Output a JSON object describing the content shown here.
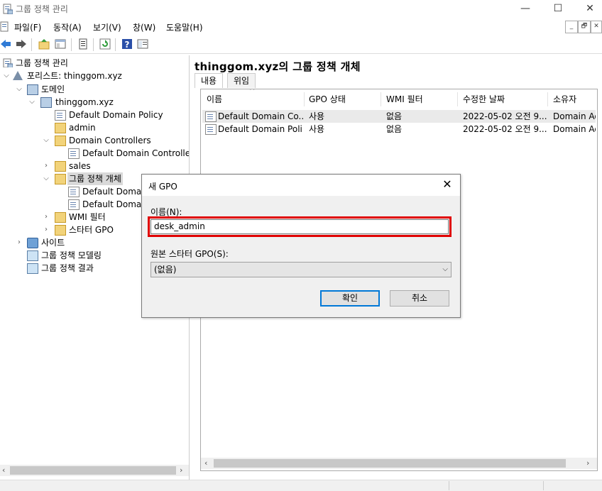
{
  "window": {
    "title": "그룹 정책 관리",
    "controls": {
      "minimize": "—",
      "maximize": "☐",
      "close": "✕"
    }
  },
  "menu": {
    "items": [
      "파일(F)",
      "동작(A)",
      "보기(V)",
      "창(W)",
      "도움말(H)"
    ],
    "mdi": {
      "minimize": "_",
      "restore": "🗗",
      "close": "✕"
    }
  },
  "toolbar": {
    "icons": [
      "back-arrow-icon",
      "forward-arrow-icon",
      "up-folder-icon",
      "show-tree-icon",
      "properties-icon",
      "refresh-icon",
      "help-icon",
      "console-icon"
    ]
  },
  "tree": {
    "root": "그룹 정책 관리",
    "forest": "포리스트: thinggom.xyz",
    "domains": "도메인",
    "domain": "thinggom.xyz",
    "default_domain_policy": "Default Domain Policy",
    "admin": "admin",
    "domain_controllers": "Domain Controllers",
    "default_dc_policy": "Default Domain Controllers",
    "sales": "sales",
    "gpo_objects": "그룹 정책 개체",
    "gpo_item1": "Default Domain",
    "gpo_item2": "Default Domain",
    "wmi_filters": "WMI 필터",
    "starter_gpos": "스타터 GPO",
    "sites": "사이트",
    "modeling": "그룹 정책 모델링",
    "results": "그룹 정책 결과"
  },
  "right_pane": {
    "title": "thinggom.xyz의 그룹 정책 개체",
    "tabs": [
      "내용",
      "위임"
    ],
    "columns": [
      "이름",
      "GPO 상태",
      "WMI 필터",
      "수정한 날짜",
      "소유자"
    ],
    "rows": [
      [
        "Default Domain Co...",
        "사용",
        "없음",
        "2022-05-02 오전 9...",
        "Domain Ad"
      ],
      [
        "Default Domain Poli...",
        "사용",
        "없음",
        "2022-05-02 오전 9...",
        "Domain Ad"
      ]
    ]
  },
  "dialog": {
    "title": "새 GPO",
    "name_label": "이름(N):",
    "name_value": "desk_admin",
    "starter_label": "원본 스타터 GPO(S):",
    "starter_value": "(없음)",
    "ok": "확인",
    "cancel": "취소",
    "highlight_color": "#e00000"
  }
}
